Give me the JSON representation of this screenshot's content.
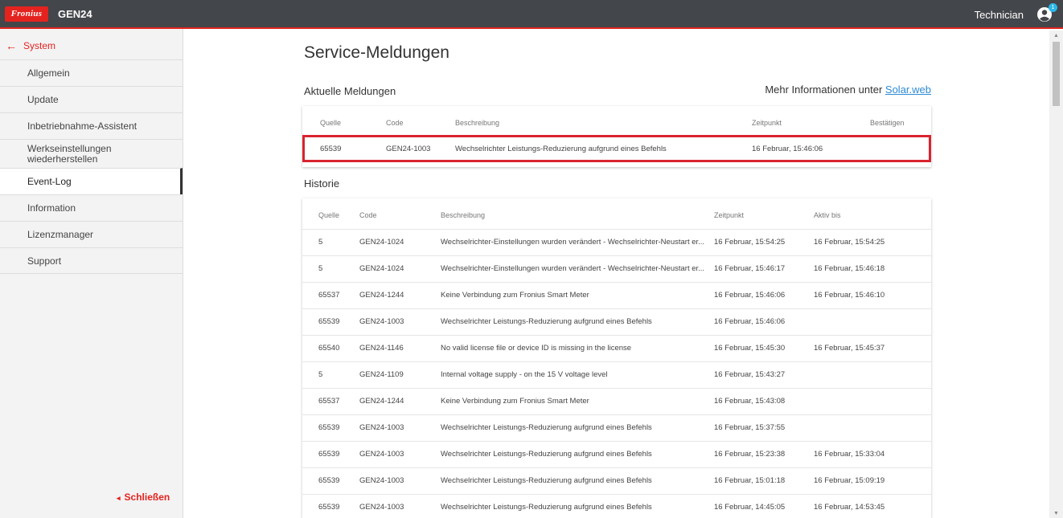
{
  "header": {
    "logo_text": "Fronius",
    "product": "GEN24",
    "user_role": "Technician",
    "notification_count": "1"
  },
  "sidebar": {
    "back_label": "System",
    "items": [
      {
        "label": "Allgemein"
      },
      {
        "label": "Update"
      },
      {
        "label": "Inbetriebnahme-Assistent"
      },
      {
        "label": "Werkseinstellungen wiederherstellen"
      },
      {
        "label": "Event-Log",
        "active": true
      },
      {
        "label": "Information"
      },
      {
        "label": "Lizenzmanager"
      },
      {
        "label": "Support"
      }
    ],
    "close_label": "Schließen"
  },
  "main": {
    "title": "Service-Meldungen",
    "current": {
      "title": "Aktuelle Meldungen",
      "more_info_prefix": "Mehr Informationen unter",
      "more_info_link": "Solar.web",
      "columns": [
        "Quelle",
        "Code",
        "Beschreibung",
        "Zeitpunkt",
        "Bestätigen"
      ],
      "rows": [
        {
          "quelle": "65539",
          "code": "GEN24-1003",
          "beschreibung": "Wechselrichter Leistungs-Reduzierung aufgrund eines Befehls",
          "zeitpunkt": "16 Februar, 15:46:06",
          "bestaetigen": ""
        }
      ]
    },
    "history": {
      "title": "Historie",
      "columns": [
        "Quelle",
        "Code",
        "Beschreibung",
        "Zeitpunkt",
        "Aktiv bis"
      ],
      "rows": [
        {
          "quelle": "5",
          "code": "GEN24-1024",
          "beschreibung": "Wechselrichter-Einstellungen wurden verändert - Wechselrichter-Neustart er...",
          "zeitpunkt": "16 Februar, 15:54:25",
          "aktiv_bis": "16 Februar, 15:54:25"
        },
        {
          "quelle": "5",
          "code": "GEN24-1024",
          "beschreibung": "Wechselrichter-Einstellungen wurden verändert - Wechselrichter-Neustart er...",
          "zeitpunkt": "16 Februar, 15:46:17",
          "aktiv_bis": "16 Februar, 15:46:18"
        },
        {
          "quelle": "65537",
          "code": "GEN24-1244",
          "beschreibung": "Keine Verbindung zum Fronius Smart Meter",
          "zeitpunkt": "16 Februar, 15:46:06",
          "aktiv_bis": "16 Februar, 15:46:10"
        },
        {
          "quelle": "65539",
          "code": "GEN24-1003",
          "beschreibung": "Wechselrichter Leistungs-Reduzierung aufgrund eines Befehls",
          "zeitpunkt": "16 Februar, 15:46:06",
          "aktiv_bis": ""
        },
        {
          "quelle": "65540",
          "code": "GEN24-1146",
          "beschreibung": "No valid license file or device ID is missing in the license",
          "zeitpunkt": "16 Februar, 15:45:30",
          "aktiv_bis": "16 Februar, 15:45:37"
        },
        {
          "quelle": "5",
          "code": "GEN24-1109",
          "beschreibung": "Internal voltage supply - on the 15 V voltage level",
          "zeitpunkt": "16 Februar, 15:43:27",
          "aktiv_bis": ""
        },
        {
          "quelle": "65537",
          "code": "GEN24-1244",
          "beschreibung": "Keine Verbindung zum Fronius Smart Meter",
          "zeitpunkt": "16 Februar, 15:43:08",
          "aktiv_bis": ""
        },
        {
          "quelle": "65539",
          "code": "GEN24-1003",
          "beschreibung": "Wechselrichter Leistungs-Reduzierung aufgrund eines Befehls",
          "zeitpunkt": "16 Februar, 15:37:55",
          "aktiv_bis": ""
        },
        {
          "quelle": "65539",
          "code": "GEN24-1003",
          "beschreibung": "Wechselrichter Leistungs-Reduzierung aufgrund eines Befehls",
          "zeitpunkt": "16 Februar, 15:23:38",
          "aktiv_bis": "16 Februar, 15:33:04"
        },
        {
          "quelle": "65539",
          "code": "GEN24-1003",
          "beschreibung": "Wechselrichter Leistungs-Reduzierung aufgrund eines Befehls",
          "zeitpunkt": "16 Februar, 15:01:18",
          "aktiv_bis": "16 Februar, 15:09:19"
        },
        {
          "quelle": "65539",
          "code": "GEN24-1003",
          "beschreibung": "Wechselrichter Leistungs-Reduzierung aufgrund eines Befehls",
          "zeitpunkt": "16 Februar, 14:45:05",
          "aktiv_bis": "16 Februar, 14:53:45"
        }
      ]
    }
  },
  "colors": {
    "brand_red": "#e4231f",
    "header_bg": "#43464a",
    "link_blue": "#2f8bd6",
    "badge_blue": "#2bb7e8"
  },
  "icons": {
    "back": "arrow-left-icon",
    "user": "user-circle-icon",
    "close": "chevron-left-icon"
  }
}
